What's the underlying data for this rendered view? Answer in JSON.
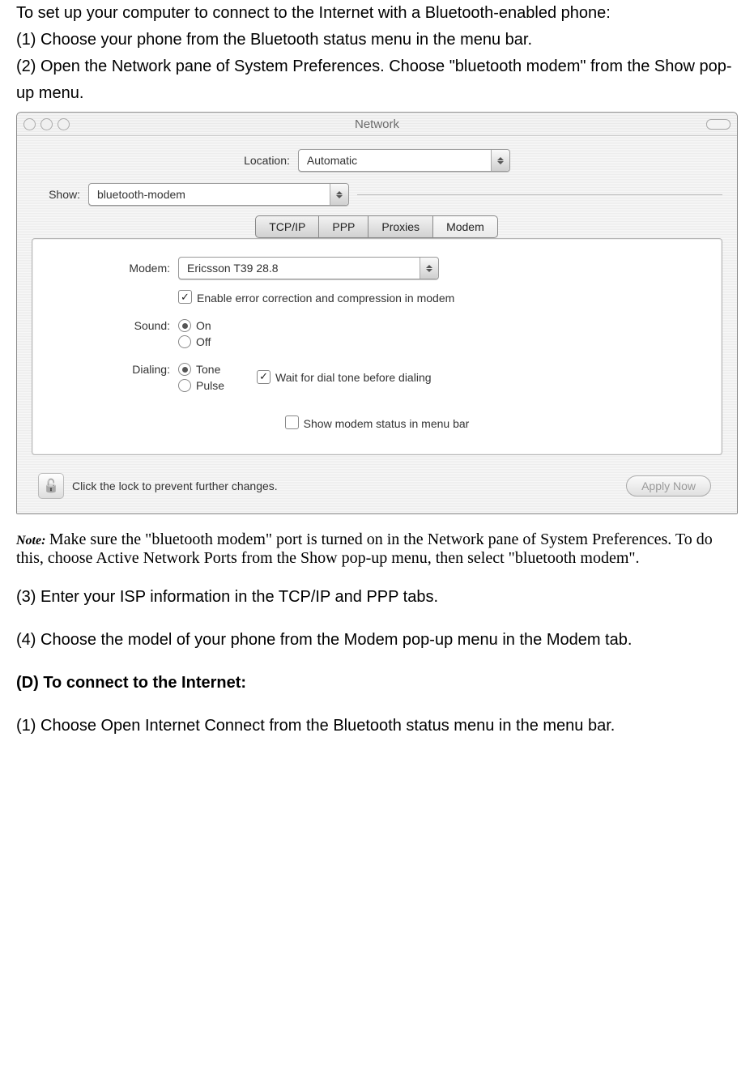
{
  "doc": {
    "intro": "To set up your computer to connect to the Internet with a Bluetooth-enabled phone:",
    "step1": "(1) Choose your phone from the Bluetooth status menu in the menu bar.",
    "step2": "(2) Open the Network pane of System Preferences. Choose \"bluetooth modem\" from the Show pop-up menu.",
    "note_label": "Note:",
    "note_body": "Make sure the \"bluetooth modem\" port is turned on in the Network pane of System Preferences. To do this, choose Active Network Ports from the Show pop-up menu, then select \"bluetooth modem\".",
    "step3": "(3) Enter your ISP information in the TCP/IP and PPP tabs.",
    "step4": "(4) Choose the model of your phone from the Modem pop-up menu in the Modem tab.",
    "sectionD": "(D) To connect to the Internet:",
    "d_step1": "(1) Choose Open Internet Connect from the Bluetooth status menu in the menu bar."
  },
  "win": {
    "title": "Network",
    "location_label": "Location:",
    "location_value": "Automatic",
    "show_label": "Show:",
    "show_value": "bluetooth-modem",
    "tabs": {
      "tcpip": "TCP/IP",
      "ppp": "PPP",
      "proxies": "Proxies",
      "modem": "Modem"
    },
    "modem": {
      "modem_label": "Modem:",
      "modem_value": "Ericsson T39 28.8",
      "errcomp_label": "Enable error correction and compression in modem",
      "sound_label": "Sound:",
      "sound_on": "On",
      "sound_off": "Off",
      "dialing_label": "Dialing:",
      "dial_tone": "Tone",
      "dial_pulse": "Pulse",
      "wait_label": "Wait for dial tone before dialing",
      "show_status_label": "Show modem status in menu bar"
    },
    "lock_text": "Click the lock to prevent further changes.",
    "apply_btn": "Apply Now"
  }
}
